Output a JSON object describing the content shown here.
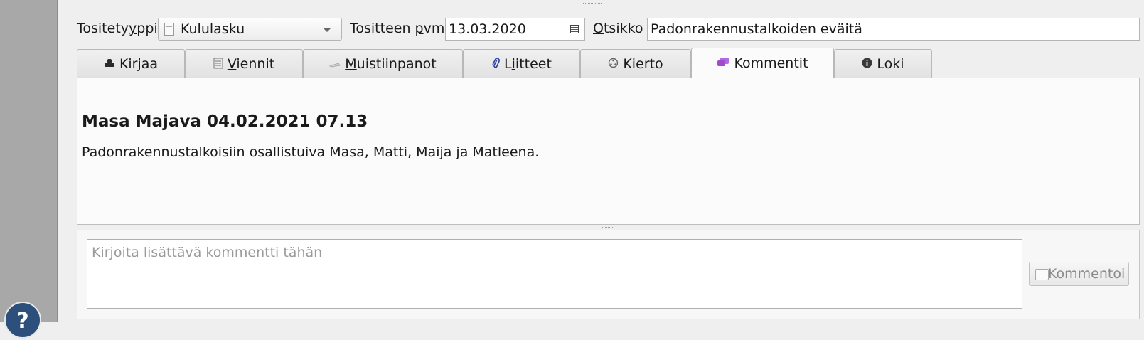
{
  "form": {
    "type_label_a": "Tositety",
    "type_label_u": "y",
    "type_label_b": "ppi",
    "type_value": "Kululasku",
    "date_label_a": "Tositteen ",
    "date_label_u": "p",
    "date_label_b": "vm",
    "date_value": "13.03.2020",
    "title_label_u": "O",
    "title_label_b": "tsikko",
    "title_value": "Padonrakennustalkoiden eväitä"
  },
  "tabs": [
    {
      "label_u": "",
      "label_b": "Kirjaa",
      "icon": "stamp-icon"
    },
    {
      "label_u": "V",
      "label_b": "iennit",
      "icon": "ledger-icon"
    },
    {
      "label_u": "M",
      "label_b": "uistiinpanot",
      "icon": "note-icon"
    },
    {
      "label_a": "L",
      "label_u": "i",
      "label_b": "itteet",
      "icon": "paperclip-icon"
    },
    {
      "label_u": "",
      "label_b": "Kierto",
      "icon": "cycle-icon"
    },
    {
      "label_u": "",
      "label_b": "Kommentit",
      "icon": "comments-icon"
    },
    {
      "label_u": "",
      "label_b": "Loki",
      "icon": "info-icon"
    }
  ],
  "active_tab": "Kommentit",
  "comments": [
    {
      "author_line": "Masa Majava 04.02.2021 07.13",
      "text": "Padonrakennustalkoisiin osallistuiva Masa, Matti, Maija ja Matleena."
    }
  ],
  "new_comment": {
    "placeholder": "Kirjoita lisättävä kommentti tähän",
    "button_label": "Kommentoi"
  },
  "help_label": "?",
  "colors": {
    "comment_tab_icon": "#a04ad0",
    "liitteet_icon": "#2c3fa0",
    "help_button": "#2c4f7c"
  }
}
